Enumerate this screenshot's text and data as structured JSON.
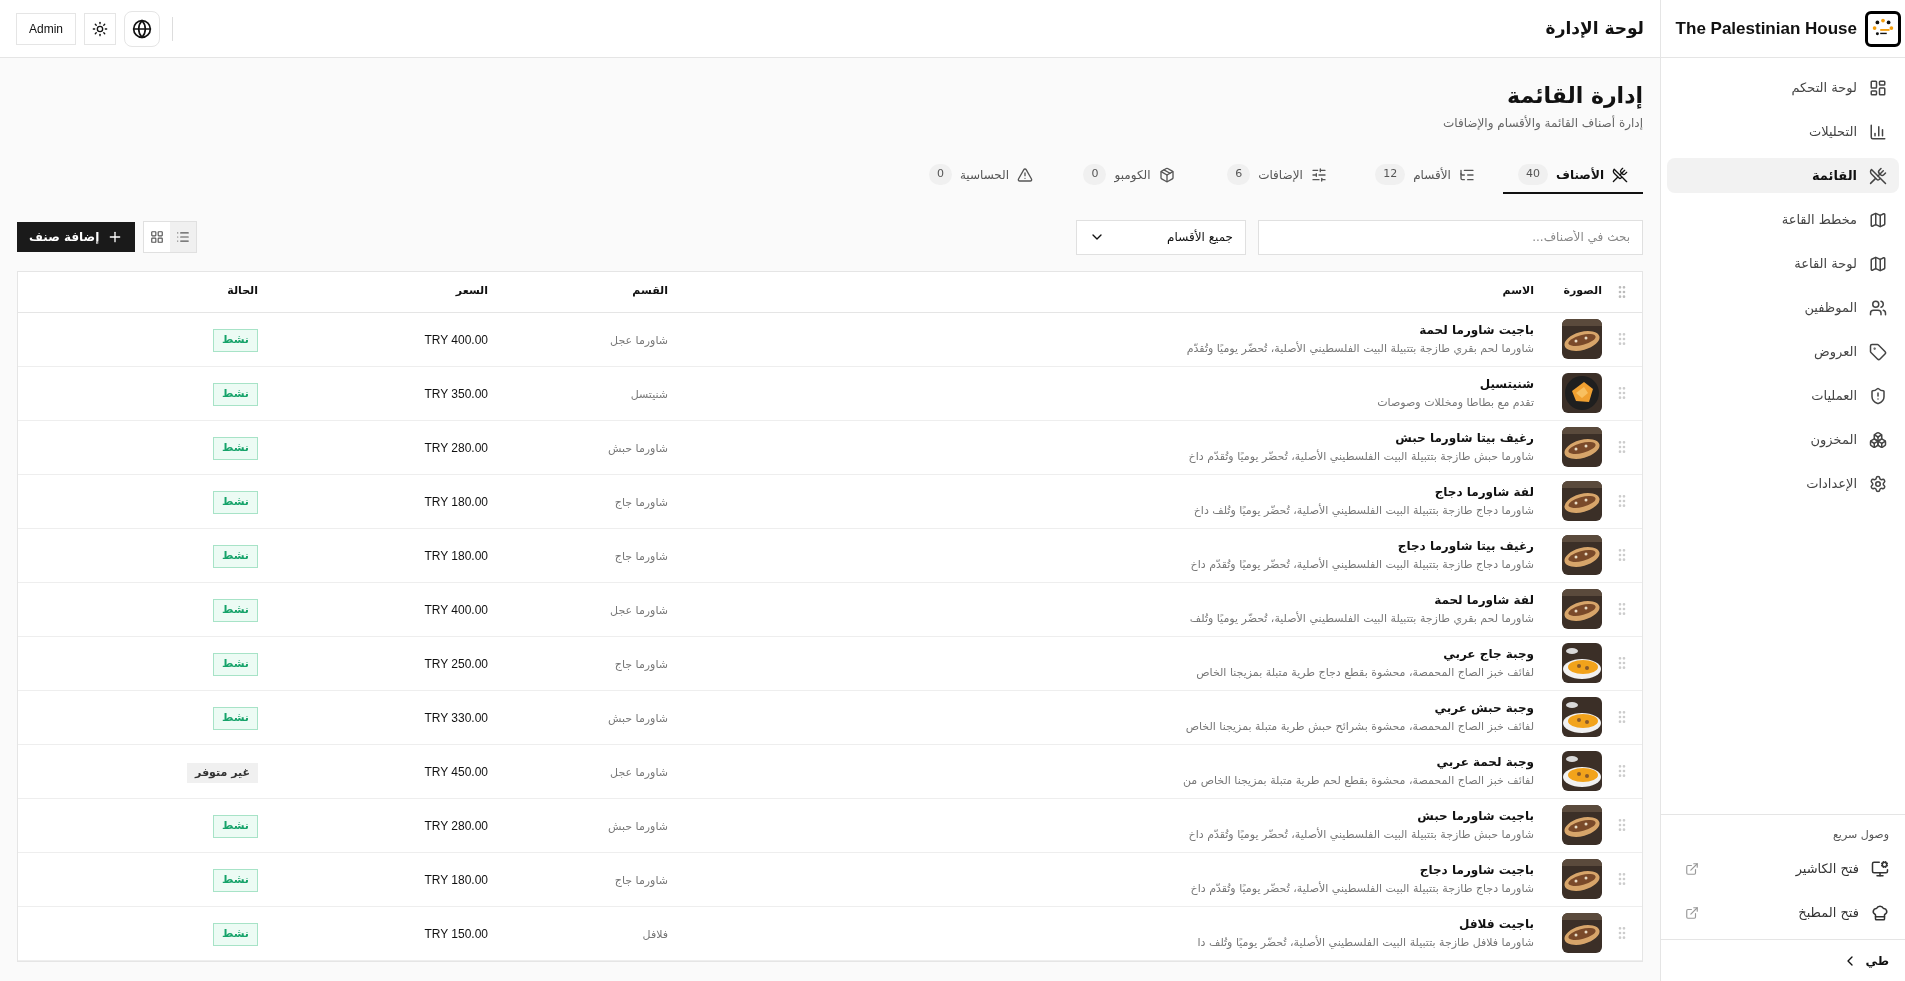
{
  "brand": {
    "name": "The Palestinian House"
  },
  "header": {
    "title": "لوحة الإدارة",
    "user_button": "Admin"
  },
  "sidebar": {
    "items": [
      {
        "label": "لوحة التحكم",
        "selected": false
      },
      {
        "label": "التحليلات",
        "selected": false
      },
      {
        "label": "القائمة",
        "selected": true
      },
      {
        "label": "مخطط القاعة",
        "selected": false
      },
      {
        "label": "لوحة القاعة",
        "selected": false
      },
      {
        "label": "الموظفين",
        "selected": false
      },
      {
        "label": "العروض",
        "selected": false
      },
      {
        "label": "العمليات",
        "selected": false
      },
      {
        "label": "المخزون",
        "selected": false
      },
      {
        "label": "الإعدادات",
        "selected": false
      }
    ],
    "quick_access": {
      "heading": "وصول سريع",
      "links": [
        {
          "label": "فتح الكاشير"
        },
        {
          "label": "فتح المطبخ"
        }
      ]
    },
    "collapse": {
      "label": "طي"
    }
  },
  "page": {
    "title": "إدارة القائمة",
    "subtitle": "إدارة أصناف القائمة والأقسام والإضافات"
  },
  "tabs": [
    {
      "label": "الأصناف",
      "count": "40",
      "selected": true
    },
    {
      "label": "الأقسام",
      "count": "12",
      "selected": false
    },
    {
      "label": "الإضافات",
      "count": "6",
      "selected": false
    },
    {
      "label": "الكومبو",
      "count": "0",
      "selected": false
    },
    {
      "label": "الحساسية",
      "count": "0",
      "selected": false
    }
  ],
  "toolbar": {
    "search": {
      "placeholder": "بحث في الأصناف..."
    },
    "category_filter": {
      "value": "جميع الأقسام"
    },
    "views": [
      {
        "kind": "list",
        "selected": true
      },
      {
        "kind": "grid",
        "selected": false
      }
    ],
    "add_button": "إضافة صنف"
  },
  "table": {
    "columns": [
      "الصورة",
      "الاسم",
      "القسم",
      "السعر",
      "الحالة"
    ],
    "rows": [
      {
        "name": "باجيت شاورما لحمة",
        "description": "شاورما لحم بقري طازجة بتتبيلة البيت الفلسطيني الأصلية، تُحضّر يوميًا وتُقدّم",
        "category": "شاورما عجل",
        "price": "TRY 400.00",
        "status": {
          "kind": "active",
          "label": "نشط"
        }
      },
      {
        "name": "شنيتسيل",
        "description": "تقدم مع بطاطا ومخللات وصوصات",
        "category": "شنيتسل",
        "price": "TRY 350.00",
        "status": {
          "kind": "active",
          "label": "نشط"
        }
      },
      {
        "name": "رغيف بيتا شاورما حبش",
        "description": "شاورما حبش طازجة بتتبيلة البيت الفلسطيني الأصلية، تُحضّر يوميًا وتُقدّم داخ",
        "category": "شاورما حبش",
        "price": "TRY 280.00",
        "status": {
          "kind": "active",
          "label": "نشط"
        }
      },
      {
        "name": "لفة شاورما دجاج",
        "description": "شاورما دجاج طازجة بتتبيلة البيت الفلسطيني الأصلية، تُحضّر يوميًا وتُلف داخ",
        "category": "شاورما جاج",
        "price": "TRY 180.00",
        "status": {
          "kind": "active",
          "label": "نشط"
        }
      },
      {
        "name": "رغيف بيتا شاورما دجاج",
        "description": "شاورما دجاج طازجة بتتبيلة البيت الفلسطيني الأصلية، تُحضّر يوميًا وتُقدّم داخ",
        "category": "شاورما جاج",
        "price": "TRY 180.00",
        "status": {
          "kind": "active",
          "label": "نشط"
        }
      },
      {
        "name": "لفة شاورما لحمة",
        "description": "شاورما لحم بقري طازجة بتتبيلة البيت الفلسطيني الأصلية، تُحضّر يوميًا وتُلف",
        "category": "شاورما عجل",
        "price": "TRY 400.00",
        "status": {
          "kind": "active",
          "label": "نشط"
        }
      },
      {
        "name": "وجبة جاج عربي",
        "description": "لفائف خبز الصاج المحمصة، محشوة بقطع دجاج طرية متبلة بمزيجنا الخاص",
        "category": "شاورما جاج",
        "price": "TRY 250.00",
        "status": {
          "kind": "active",
          "label": "نشط"
        }
      },
      {
        "name": "وجبة حبش عربي",
        "description": "لفائف خبز الصاج المحمصة، محشوة بشرائح حبش طرية متبلة بمزيجنا الخاص",
        "category": "شاورما حبش",
        "price": "TRY 330.00",
        "status": {
          "kind": "active",
          "label": "نشط"
        }
      },
      {
        "name": "وجبة لحمة عربي",
        "description": "لفائف خبز الصاج المحمصة، محشوة بقطع لحم طرية متبلة بمزيجنا الخاص من",
        "category": "شاورما عجل",
        "price": "TRY 450.00",
        "status": {
          "kind": "unavailable",
          "label": "غير متوفر"
        }
      },
      {
        "name": "باجيت شاورما حبش",
        "description": "شاورما حبش طازجة بتتبيلة البيت الفلسطيني الأصلية، تُحضّر يوميًا وتُقدّم داخ",
        "category": "شاورما حبش",
        "price": "TRY 280.00",
        "status": {
          "kind": "active",
          "label": "نشط"
        }
      },
      {
        "name": "باجيت شاورما دجاج",
        "description": "شاورما دجاج طازجة بتتبيلة البيت الفلسطيني الأصلية، تُحضّر يوميًا وتُقدّم داخ",
        "category": "شاورما جاج",
        "price": "TRY 180.00",
        "status": {
          "kind": "active",
          "label": "نشط"
        }
      },
      {
        "name": "باجيت فلافل",
        "description": "شاورما فلافل طازجة بتتبيلة البيت الفلسطيني الأصلية، تُحضّر يوميًا وتُلف دا",
        "category": "فلافل",
        "price": "TRY 150.00",
        "status": {
          "kind": "active",
          "label": "نشط"
        }
      }
    ]
  }
}
